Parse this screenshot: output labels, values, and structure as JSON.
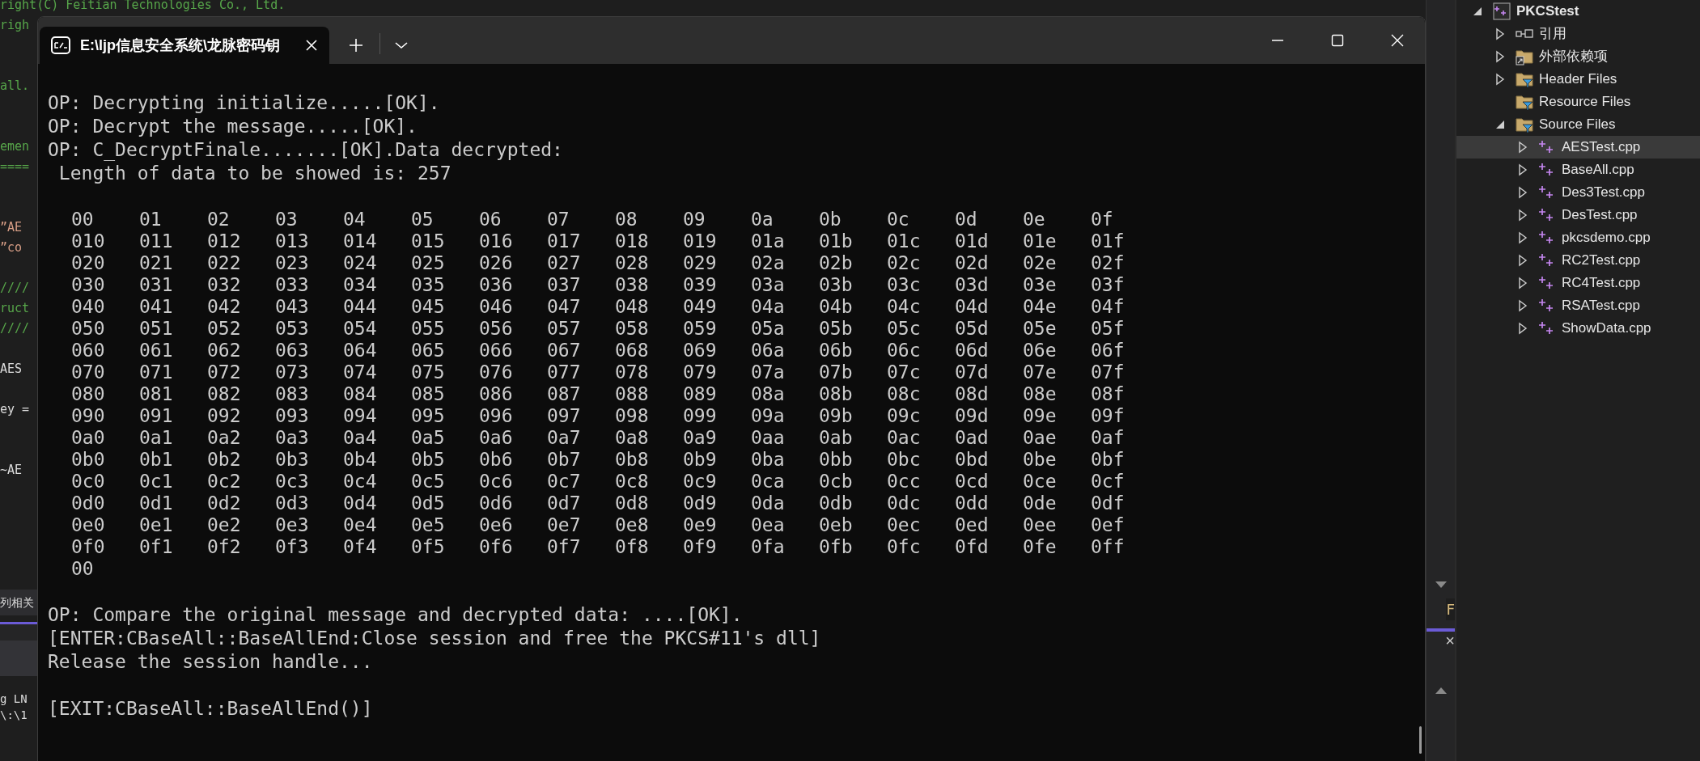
{
  "editor": {
    "code_lines": [
      {
        "kind": "comment",
        "text": "right(C) Feitian Technologies Co., Ltd."
      },
      {
        "kind": "comment",
        "text": "righ"
      },
      {
        "kind": "comment",
        "text": "all."
      },
      {
        "kind": "comment",
        "text": "emen"
      },
      {
        "kind": "comment",
        "text": "===="
      },
      {
        "kind": "string",
        "text": "”AE"
      },
      {
        "kind": "string",
        "text": "”co"
      },
      {
        "kind": "comment",
        "text": "////"
      },
      {
        "kind": "comment",
        "text": "ruct"
      },
      {
        "kind": "comment",
        "text": "////"
      },
      {
        "kind": "code",
        "text": "AES"
      },
      {
        "kind": "code",
        "text": "ey ="
      },
      {
        "kind": "code",
        "text": "~AE"
      }
    ],
    "panel_tab": "列相关",
    "output_lines": [
      "g LN",
      "\\:\\1"
    ],
    "strip_text": "F",
    "panel_close": "×"
  },
  "terminal": {
    "tab_title": "E:\\ljp信息安全系统\\龙脉密码钥",
    "lines": [
      {
        "kind": "text",
        "text": "OP: Decrypting initialize.....[OK]."
      },
      {
        "kind": "text",
        "text": "OP: Decrypt the message.....[OK]."
      },
      {
        "kind": "text",
        "text": "OP: C_DecryptFinale.......[OK].Data decrypted:"
      },
      {
        "kind": "text",
        "text": " Length of data to be showed is: 257"
      },
      {
        "kind": "blank"
      },
      {
        "kind": "hex",
        "cells": [
          "00",
          "01",
          "02",
          "03",
          "04",
          "05",
          "06",
          "07",
          "08",
          "09",
          "0a",
          "0b",
          "0c",
          "0d",
          "0e",
          "0f"
        ]
      },
      {
        "kind": "hex",
        "cells": [
          "010",
          "011",
          "012",
          "013",
          "014",
          "015",
          "016",
          "017",
          "018",
          "019",
          "01a",
          "01b",
          "01c",
          "01d",
          "01e",
          "01f"
        ]
      },
      {
        "kind": "hex",
        "cells": [
          "020",
          "021",
          "022",
          "023",
          "024",
          "025",
          "026",
          "027",
          "028",
          "029",
          "02a",
          "02b",
          "02c",
          "02d",
          "02e",
          "02f"
        ]
      },
      {
        "kind": "hex",
        "cells": [
          "030",
          "031",
          "032",
          "033",
          "034",
          "035",
          "036",
          "037",
          "038",
          "039",
          "03a",
          "03b",
          "03c",
          "03d",
          "03e",
          "03f"
        ]
      },
      {
        "kind": "hex",
        "cells": [
          "040",
          "041",
          "042",
          "043",
          "044",
          "045",
          "046",
          "047",
          "048",
          "049",
          "04a",
          "04b",
          "04c",
          "04d",
          "04e",
          "04f"
        ]
      },
      {
        "kind": "hex",
        "cells": [
          "050",
          "051",
          "052",
          "053",
          "054",
          "055",
          "056",
          "057",
          "058",
          "059",
          "05a",
          "05b",
          "05c",
          "05d",
          "05e",
          "05f"
        ]
      },
      {
        "kind": "hex",
        "cells": [
          "060",
          "061",
          "062",
          "063",
          "064",
          "065",
          "066",
          "067",
          "068",
          "069",
          "06a",
          "06b",
          "06c",
          "06d",
          "06e",
          "06f"
        ]
      },
      {
        "kind": "hex",
        "cells": [
          "070",
          "071",
          "072",
          "073",
          "074",
          "075",
          "076",
          "077",
          "078",
          "079",
          "07a",
          "07b",
          "07c",
          "07d",
          "07e",
          "07f"
        ]
      },
      {
        "kind": "hex",
        "cells": [
          "080",
          "081",
          "082",
          "083",
          "084",
          "085",
          "086",
          "087",
          "088",
          "089",
          "08a",
          "08b",
          "08c",
          "08d",
          "08e",
          "08f"
        ]
      },
      {
        "kind": "hex",
        "cells": [
          "090",
          "091",
          "092",
          "093",
          "094",
          "095",
          "096",
          "097",
          "098",
          "099",
          "09a",
          "09b",
          "09c",
          "09d",
          "09e",
          "09f"
        ]
      },
      {
        "kind": "hex",
        "cells": [
          "0a0",
          "0a1",
          "0a2",
          "0a3",
          "0a4",
          "0a5",
          "0a6",
          "0a7",
          "0a8",
          "0a9",
          "0aa",
          "0ab",
          "0ac",
          "0ad",
          "0ae",
          "0af"
        ]
      },
      {
        "kind": "hex",
        "cells": [
          "0b0",
          "0b1",
          "0b2",
          "0b3",
          "0b4",
          "0b5",
          "0b6",
          "0b7",
          "0b8",
          "0b9",
          "0ba",
          "0bb",
          "0bc",
          "0bd",
          "0be",
          "0bf"
        ]
      },
      {
        "kind": "hex",
        "cells": [
          "0c0",
          "0c1",
          "0c2",
          "0c3",
          "0c4",
          "0c5",
          "0c6",
          "0c7",
          "0c8",
          "0c9",
          "0ca",
          "0cb",
          "0cc",
          "0cd",
          "0ce",
          "0cf"
        ]
      },
      {
        "kind": "hex",
        "cells": [
          "0d0",
          "0d1",
          "0d2",
          "0d3",
          "0d4",
          "0d5",
          "0d6",
          "0d7",
          "0d8",
          "0d9",
          "0da",
          "0db",
          "0dc",
          "0dd",
          "0de",
          "0df"
        ]
      },
      {
        "kind": "hex",
        "cells": [
          "0e0",
          "0e1",
          "0e2",
          "0e3",
          "0e4",
          "0e5",
          "0e6",
          "0e7",
          "0e8",
          "0e9",
          "0ea",
          "0eb",
          "0ec",
          "0ed",
          "0ee",
          "0ef"
        ]
      },
      {
        "kind": "hex",
        "cells": [
          "0f0",
          "0f1",
          "0f2",
          "0f3",
          "0f4",
          "0f5",
          "0f6",
          "0f7",
          "0f8",
          "0f9",
          "0fa",
          "0fb",
          "0fc",
          "0fd",
          "0fe",
          "0ff"
        ]
      },
      {
        "kind": "hex",
        "cells": [
          "00"
        ]
      },
      {
        "kind": "blank"
      },
      {
        "kind": "text",
        "text": "OP: Compare the original message and decrypted data: ....[OK]."
      },
      {
        "kind": "text",
        "text": "[ENTER:CBaseAll::BaseAllEnd:Close session and free the PKCS#11's dll]"
      },
      {
        "kind": "text",
        "text": "Release the session handle..."
      },
      {
        "kind": "blank"
      },
      {
        "kind": "text",
        "text": "[EXIT:CBaseAll::BaseAllEnd()]"
      }
    ]
  },
  "solution_explorer": {
    "tree": [
      {
        "kind": "project",
        "label": "PKCStest",
        "expandable": true,
        "expanded": true,
        "selected": false,
        "children": [
          {
            "kind": "references",
            "label": "引用",
            "expandable": true,
            "expanded": false,
            "selected": false
          },
          {
            "kind": "external",
            "label": "外部依赖项",
            "expandable": true,
            "expanded": false,
            "selected": false
          },
          {
            "kind": "filter",
            "label": "Header Files",
            "expandable": true,
            "expanded": false,
            "selected": false
          },
          {
            "kind": "filter",
            "label": "Resource Files",
            "expandable": false,
            "selected": false
          },
          {
            "kind": "filter",
            "label": "Source Files",
            "expandable": true,
            "expanded": true,
            "selected": false,
            "children": [
              {
                "kind": "cpp",
                "label": "AESTest.cpp",
                "expandable": true,
                "expanded": false,
                "selected": true
              },
              {
                "kind": "cpp",
                "label": "BaseAll.cpp",
                "expandable": true,
                "expanded": false,
                "selected": false
              },
              {
                "kind": "cpp",
                "label": "Des3Test.cpp",
                "expandable": true,
                "expanded": false,
                "selected": false
              },
              {
                "kind": "cpp",
                "label": "DesTest.cpp",
                "expandable": true,
                "expanded": false,
                "selected": false
              },
              {
                "kind": "cpp",
                "label": "pkcsdemo.cpp",
                "expandable": true,
                "expanded": false,
                "selected": false
              },
              {
                "kind": "cpp",
                "label": "RC2Test.cpp",
                "expandable": true,
                "expanded": false,
                "selected": false
              },
              {
                "kind": "cpp",
                "label": "RC4Test.cpp",
                "expandable": true,
                "expanded": false,
                "selected": false
              },
              {
                "kind": "cpp",
                "label": "RSATest.cpp",
                "expandable": true,
                "expanded": false,
                "selected": false
              },
              {
                "kind": "cpp",
                "label": "ShowData.cpp",
                "expandable": true,
                "expanded": false,
                "selected": false
              }
            ]
          }
        ]
      }
    ]
  }
}
